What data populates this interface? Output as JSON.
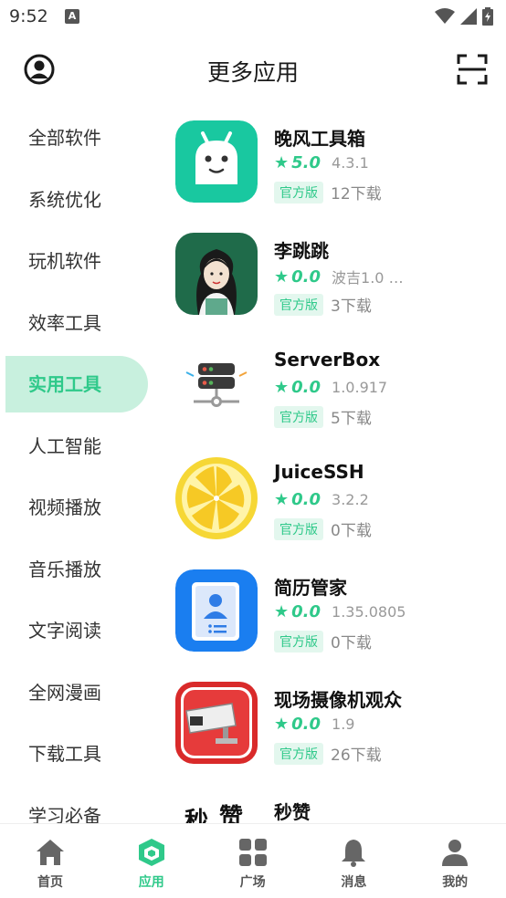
{
  "status_bar": {
    "time": "9:52",
    "notif_letter": "A"
  },
  "header": {
    "title": "更多应用",
    "profile_icon": "account-circle-icon",
    "scan_icon": "scan-icon"
  },
  "sidebar": {
    "active_index": 4,
    "items": [
      {
        "label": "全部软件"
      },
      {
        "label": "系统优化"
      },
      {
        "label": "玩机软件"
      },
      {
        "label": "效率工具"
      },
      {
        "label": "实用工具"
      },
      {
        "label": "人工智能"
      },
      {
        "label": "视频播放"
      },
      {
        "label": "音乐播放"
      },
      {
        "label": "文字阅读"
      },
      {
        "label": "全网漫画"
      },
      {
        "label": "下载工具"
      },
      {
        "label": "学习必备"
      }
    ]
  },
  "apps": [
    {
      "name": "晚风工具箱",
      "score": "5.0",
      "version": "4.3.1",
      "badge": "官方版",
      "downloads": "12下载",
      "icon": "android-face-icon"
    },
    {
      "name": "李跳跳",
      "score": "0.0",
      "version": "波吉1.0 …",
      "badge": "官方版",
      "downloads": "3下载",
      "icon": "girl-avatar-icon"
    },
    {
      "name": "ServerBox",
      "score": "0.0",
      "version": "1.0.917",
      "badge": "官方版",
      "downloads": "5下载",
      "icon": "server-icon"
    },
    {
      "name": "JuiceSSH",
      "score": "0.0",
      "version": "3.2.2",
      "badge": "官方版",
      "downloads": "0下载",
      "icon": "lemon-icon"
    },
    {
      "name": "简历管家",
      "score": "0.0",
      "version": "1.35.0805",
      "badge": "官方版",
      "downloads": "0下载",
      "icon": "resume-icon"
    },
    {
      "name": "现场摄像机观众",
      "score": "0.0",
      "version": "1.9",
      "badge": "官方版",
      "downloads": "26下载",
      "icon": "camera-icon"
    },
    {
      "name": "秒赞",
      "icon": "miaozan-logo-icon",
      "icon_text": "秒赞"
    }
  ],
  "bottom_nav": [
    {
      "label": "首页",
      "icon": "home-icon"
    },
    {
      "label": "应用",
      "icon": "cube-icon",
      "active": true
    },
    {
      "label": "广场",
      "icon": "grid-icon"
    },
    {
      "label": "消息",
      "icon": "bell-icon"
    },
    {
      "label": "我的",
      "icon": "person-icon"
    }
  ],
  "colors": {
    "accent": "#2fc98a",
    "accent_light": "#c8f0de",
    "badge_bg": "#e3f7ee"
  }
}
